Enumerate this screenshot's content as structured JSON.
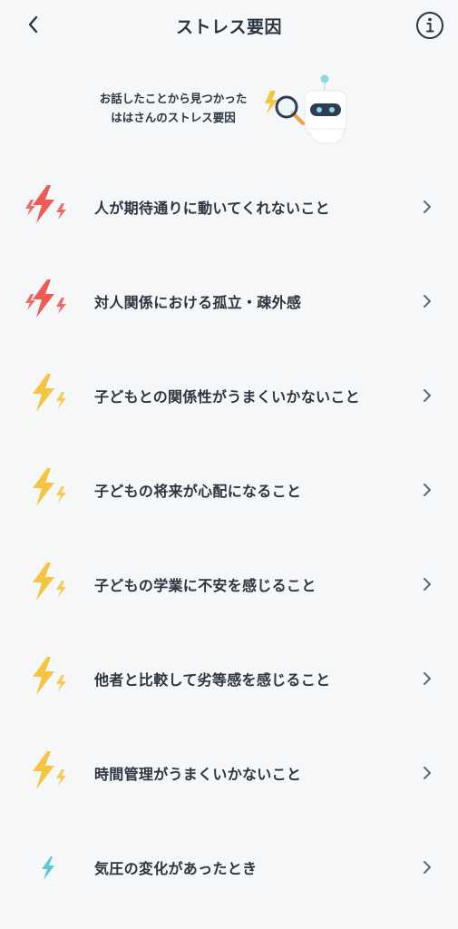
{
  "header": {
    "title": "ストレス要因",
    "back_icon": "chevron-left-icon",
    "info_icon": "info-icon"
  },
  "hero": {
    "line1": "お話したことから見つかった",
    "line2": "ははさんのストレス要因"
  },
  "colors": {
    "high": "#ef5a55",
    "medium": "#f5c542",
    "low": "#5cc9d6",
    "text": "#2a3540",
    "chevron": "#5d6b78"
  },
  "items": [
    {
      "label": "人が期待通りに動いてくれないこと",
      "level": "high"
    },
    {
      "label": "対人関係における孤立・疎外感",
      "level": "high"
    },
    {
      "label": "子どもとの関係性がうまくいかないこと",
      "level": "medium"
    },
    {
      "label": "子どもの将来が心配になること",
      "level": "medium"
    },
    {
      "label": "子どもの学業に不安を感じること",
      "level": "medium"
    },
    {
      "label": "他者と比較して劣等感を感じること",
      "level": "medium"
    },
    {
      "label": "時間管理がうまくいかないこと",
      "level": "medium"
    },
    {
      "label": "気圧の変化があったとき",
      "level": "low"
    }
  ]
}
